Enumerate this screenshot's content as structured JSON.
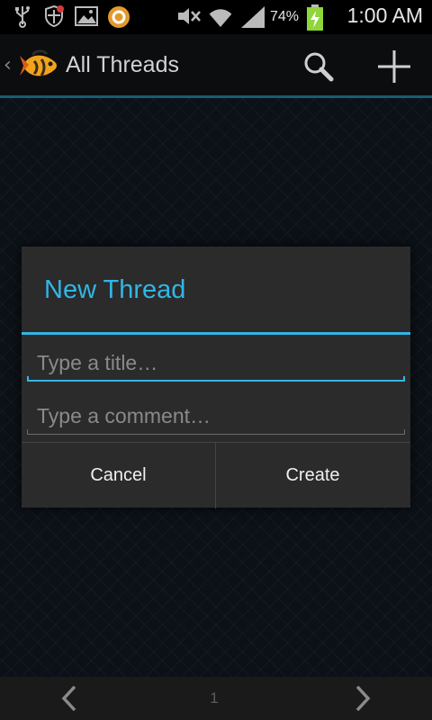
{
  "status_bar": {
    "battery_percent": "74%",
    "time": "1:00 AM",
    "icons": [
      "usb-icon",
      "shield-icon",
      "image-icon",
      "app-ring-icon",
      "mute-icon",
      "wifi-icon",
      "signal-icon",
      "battery-charging-icon"
    ]
  },
  "action_bar": {
    "back_glyph": "‹",
    "title": "All Threads",
    "actions": [
      "search-icon",
      "add-icon"
    ]
  },
  "dialog": {
    "title": "New Thread",
    "title_placeholder": "Type a title…",
    "comment_placeholder": "Type a comment…",
    "title_value": "",
    "comment_value": "",
    "cancel_label": "Cancel",
    "create_label": "Create"
  },
  "pager": {
    "page": "1"
  },
  "colors": {
    "accent": "#33b5e5",
    "dialog_bg": "#2b2b2b",
    "actionbar_bg": "#0b0d0f"
  }
}
